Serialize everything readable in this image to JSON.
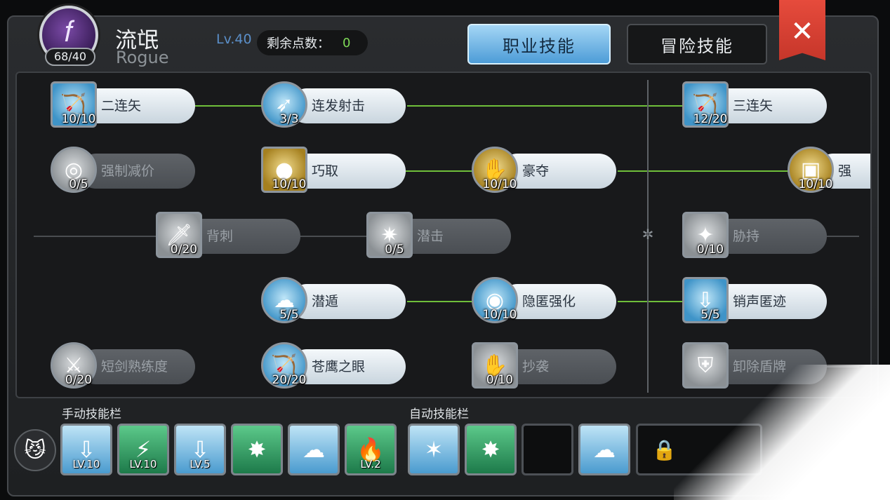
{
  "header": {
    "class_icon": "bow-feather-icon",
    "points_badge": "68/40",
    "class_name": "流氓",
    "class_name_en": "Rogue",
    "level": "Lv.40",
    "remaining_label": "剩余点数：",
    "remaining_value": "0",
    "tab_job": "职业技能",
    "tab_adventure": "冒险技能",
    "close_icon": "✕"
  },
  "skills": [
    {
      "name": "二连矢",
      "level": "10/10"
    },
    {
      "name": "连发射击",
      "level": "3/3"
    },
    {
      "name": "三连矢",
      "level": "12/20"
    },
    {
      "name": "强制减价",
      "level": "0/5"
    },
    {
      "name": "巧取",
      "level": "10/10"
    },
    {
      "name": "豪夺",
      "level": "10/10"
    },
    {
      "name": "强",
      "level": "10/10"
    },
    {
      "name": "背刺",
      "level": "0/20"
    },
    {
      "name": "潜击",
      "level": "0/5"
    },
    {
      "name": "胁持",
      "level": "0/10"
    },
    {
      "name": "潜遁",
      "level": "5/5"
    },
    {
      "name": "隐匿强化",
      "level": "10/10"
    },
    {
      "name": "销声匿迹",
      "level": "5/5"
    },
    {
      "name": "短剑熟练度",
      "level": "0/20"
    },
    {
      "name": "苍鹰之眼",
      "level": "20/20"
    },
    {
      "name": "抄袭",
      "level": "0/10"
    },
    {
      "name": "卸除盾牌",
      "level": ""
    }
  ],
  "bars": {
    "manual_label": "手动技能栏",
    "auto_label": "自动技能栏",
    "manual_slots": [
      {
        "icon": "down-arrow-icon",
        "level": "LV.10"
      },
      {
        "icon": "lightning-icon",
        "level": "LV.10"
      },
      {
        "icon": "down-arrow-person-icon",
        "level": "LV.5"
      },
      {
        "icon": "burst-icon",
        "level": ""
      },
      {
        "icon": "hide-icon",
        "level": ""
      },
      {
        "icon": "flame-icon",
        "level": "LV.2"
      }
    ],
    "auto_slots": [
      {
        "icon": "shatter-icon",
        "level": ""
      },
      {
        "icon": "burst-icon",
        "level": ""
      },
      {
        "icon": "empty",
        "level": ""
      },
      {
        "icon": "hide-icon",
        "level": ""
      }
    ]
  }
}
